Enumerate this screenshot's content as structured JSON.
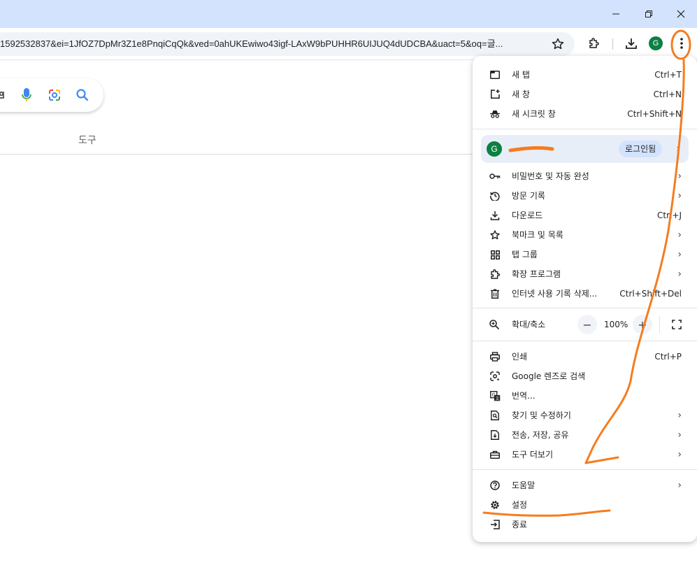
{
  "browser": {
    "url": "1592532837&ei=1JfOZ7DpMr3Z1e8PnqiCqQk&ved=0ahUKEwiwo43igf-LAxW9bPUHHR6UIJUQ4dUDCBA&uact=5&oq=글...",
    "profile_initial": "G"
  },
  "page": {
    "tools_label": "도구"
  },
  "menu": {
    "new_tab": {
      "label": "새 탭",
      "shortcut": "Ctrl+T"
    },
    "new_window": {
      "label": "새 창",
      "shortcut": "Ctrl+N"
    },
    "incognito": {
      "label": "새 시크릿 창",
      "shortcut": "Ctrl+Shift+N"
    },
    "profile": {
      "initial": "G",
      "signin_label": "로그인됨"
    },
    "passwords": {
      "label": "비밀번호 및 자동 완성"
    },
    "history": {
      "label": "방문 기록"
    },
    "downloads": {
      "label": "다운로드",
      "shortcut": "Ctrl+J"
    },
    "bookmarks": {
      "label": "북마크 및 목록"
    },
    "tab_groups": {
      "label": "탭 그룹"
    },
    "extensions": {
      "label": "확장 프로그램"
    },
    "clear_data": {
      "label": "인터넷 사용 기록 삭제...",
      "shortcut": "Ctrl+Shift+Del"
    },
    "zoom": {
      "label": "확대/축소",
      "value": "100%",
      "minus": "−",
      "plus": "+"
    },
    "print": {
      "label": "인쇄",
      "shortcut": "Ctrl+P"
    },
    "lens": {
      "label": "Google 렌즈로 검색"
    },
    "translate": {
      "label": "번역..."
    },
    "find_edit": {
      "label": "찾기 및 수정하기"
    },
    "cast_save_share": {
      "label": "전송, 저장, 공유"
    },
    "more_tools": {
      "label": "도구 더보기"
    },
    "help": {
      "label": "도움말"
    },
    "settings": {
      "label": "설정"
    },
    "exit": {
      "label": "종료"
    },
    "arrow_glyph": "›"
  },
  "colors": {
    "titlebar": "#d3e3fd",
    "avatar": "#0b8043",
    "annotation": "#f57c1f",
    "menu_bg": "#ffffff"
  }
}
